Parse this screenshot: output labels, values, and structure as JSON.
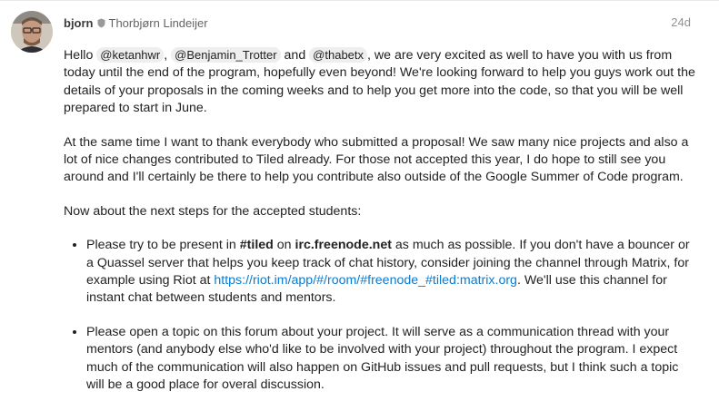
{
  "post": {
    "username": "bjorn",
    "full_name": "Thorbjørn Lindeijer",
    "date": "24d",
    "icons": {
      "avatar": "user-avatar",
      "moderator": "shield-icon"
    },
    "paragraph1": {
      "hello": "Hello",
      "mention1": "@ketanhwr",
      "sep1": ",",
      "mention2": "@Benjamin_Trotter",
      "and": "and",
      "mention3": "@thabetx",
      "rest": ", we are very excited as well to have you with us from today until the end of the program, hopefully even beyond! We're looking forward to help you guys work out the details of your proposals in the coming weeks and to help you get more into the code, so that you will be well prepared to start in June."
    },
    "paragraph2": "At the same time I want to thank everybody who submitted a proposal! We saw many nice projects and also a lot of nice changes contributed to Tiled already. For those not accepted this year, I do hope to still see you around and I'll certainly be there to help you contribute also outside of the Google Summer of Code program.",
    "paragraph3": "Now about the next steps for the accepted students:",
    "bullet1": {
      "t1": "Please try to be present in ",
      "channel": "#tiled",
      "t2": " on ",
      "server": "irc.freenode.net",
      "t3": " as much as possible. If you don't have a bouncer or a Quassel server that helps you keep track of chat history, consider joining the channel through Matrix, for example using Riot at ",
      "link": "https://riot.im/app/#/room/#freenode_#tiled:matrix.org",
      "t4": ". We'll use this channel for instant chat between students and mentors."
    },
    "bullet2": "Please open a topic on this forum about your project. It will serve as a communication thread with your mentors (and anybody else who'd like to be involved with your project) throughout the program. I expect much of the communication will also happen on GitHub issues and pull requests, but I think such a topic will be a good place for overal discussion."
  },
  "colors": {
    "link": "#0a7bd0",
    "mention_bg": "#eeeeee",
    "date": "#919191"
  }
}
